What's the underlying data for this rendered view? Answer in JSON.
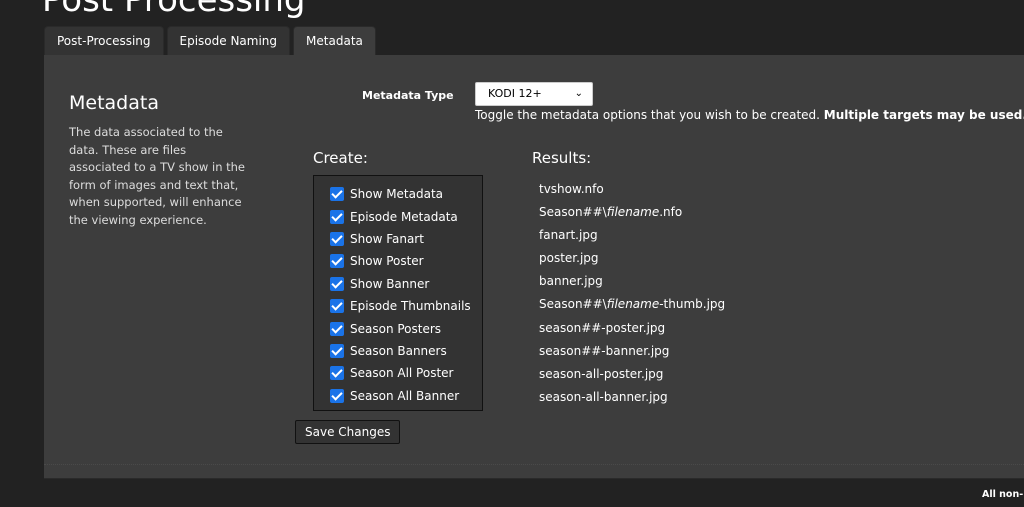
{
  "page": {
    "title": "Post Processing"
  },
  "tabs": [
    {
      "label": "Post-Processing",
      "active": false
    },
    {
      "label": "Episode Naming",
      "active": false
    },
    {
      "label": "Metadata",
      "active": true
    }
  ],
  "section": {
    "title": "Metadata",
    "description": "The data associated to the data. These are files associated to a TV show in the form of images and text that, when supported, will enhance the viewing experience."
  },
  "metadata_type": {
    "label": "Metadata Type",
    "selected": "KODI 12+",
    "chevron_icon": "chevron-down-icon"
  },
  "hint": {
    "text": "Toggle the metadata options that you wish to be created. ",
    "bold": "Multiple targets may be used."
  },
  "create": {
    "heading": "Create:",
    "items": [
      {
        "label": "Show Metadata",
        "checked": true
      },
      {
        "label": "Episode Metadata",
        "checked": true
      },
      {
        "label": "Show Fanart",
        "checked": true
      },
      {
        "label": "Show Poster",
        "checked": true
      },
      {
        "label": "Show Banner",
        "checked": true
      },
      {
        "label": "Episode Thumbnails",
        "checked": true
      },
      {
        "label": "Season Posters",
        "checked": true
      },
      {
        "label": "Season Banners",
        "checked": true
      },
      {
        "label": "Season All Poster",
        "checked": true
      },
      {
        "label": "Season All Banner",
        "checked": true
      }
    ]
  },
  "results": {
    "heading": "Results:",
    "items": [
      {
        "pre": "tvshow.nfo",
        "italic": "",
        "post": ""
      },
      {
        "pre": "Season##\\",
        "italic": "filename",
        "post": ".nfo"
      },
      {
        "pre": "fanart.jpg",
        "italic": "",
        "post": ""
      },
      {
        "pre": "poster.jpg",
        "italic": "",
        "post": ""
      },
      {
        "pre": "banner.jpg",
        "italic": "",
        "post": ""
      },
      {
        "pre": "Season##\\",
        "italic": "filename",
        "post": "-thumb.jpg"
      },
      {
        "pre": "season##-poster.jpg",
        "italic": "",
        "post": ""
      },
      {
        "pre": "season##-banner.jpg",
        "italic": "",
        "post": ""
      },
      {
        "pre": "season-all-poster.jpg",
        "italic": "",
        "post": ""
      },
      {
        "pre": "season-all-banner.jpg",
        "italic": "",
        "post": ""
      }
    ]
  },
  "save_button": {
    "label": "Save Changes"
  },
  "footer": {
    "text": "All non-"
  }
}
